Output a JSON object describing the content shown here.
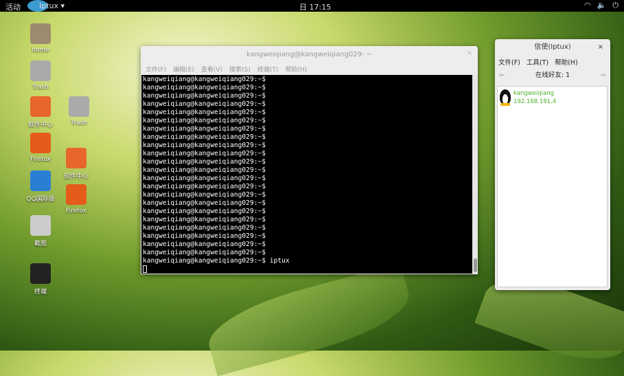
{
  "topbar": {
    "activities": "活动",
    "app_menu": "Iptux ▾",
    "clock": "日 17:15",
    "tray": [
      "wifi-icon",
      "volume-icon",
      "power-icon"
    ]
  },
  "desktop": {
    "icons": [
      {
        "label": "home"
      },
      {
        "label": "Trash"
      },
      {
        "label": "软件中心"
      },
      {
        "label": "Firefox"
      },
      {
        "label": "QQ国际版"
      },
      {
        "label": "截图"
      },
      {
        "label": "终端"
      },
      {
        "label": "Trash"
      },
      {
        "label": "软件中心"
      },
      {
        "label": "Firefox"
      }
    ]
  },
  "terminal": {
    "title": "kangweiqiang@kangweiqiang029: ~",
    "menu": [
      "文件(F)",
      "编辑(E)",
      "查看(V)",
      "搜索(S)",
      "终端(T)",
      "帮助(H)"
    ],
    "prompt": "kangweiqiang@kangweiqiang029:~$",
    "prompt_count": 22,
    "last_command": "kangweiqiang@kangweiqiang029:~$ iptux"
  },
  "iptux": {
    "title": "信使(Iptux)",
    "menu": [
      "文件(F)",
      "工具(T)",
      "帮助(H)"
    ],
    "online": "在线好友: 1",
    "peers": [
      {
        "name": "kangweiqiang",
        "ip": "192.168.191.4"
      }
    ]
  }
}
